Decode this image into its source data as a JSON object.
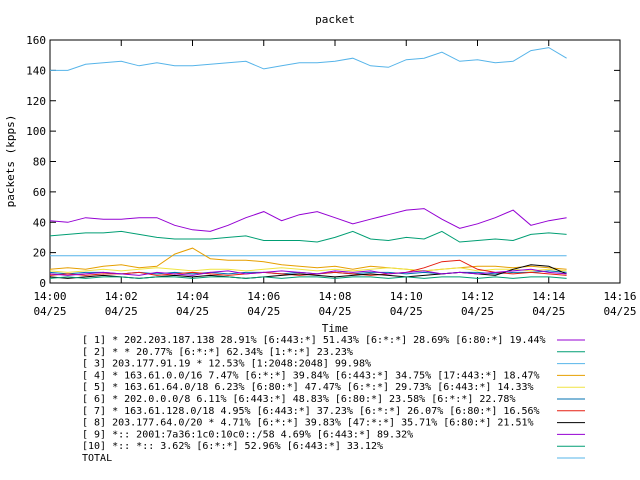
{
  "chart_data": {
    "type": "line",
    "title": "packet",
    "xlabel": "Time",
    "ylabel": "packets (kpps)",
    "ylim": [
      0,
      160
    ],
    "yticks": [
      0,
      20,
      40,
      60,
      80,
      100,
      120,
      140,
      160
    ],
    "xticks": [
      {
        "time": "14:00",
        "date": "04/25"
      },
      {
        "time": "14:02",
        "date": "04/25"
      },
      {
        "time": "14:04",
        "date": "04/25"
      },
      {
        "time": "14:06",
        "date": "04/25"
      },
      {
        "time": "14:08",
        "date": "04/25"
      },
      {
        "time": "14:10",
        "date": "04/25"
      },
      {
        "time": "14:12",
        "date": "04/25"
      },
      {
        "time": "14:14",
        "date": "04/25"
      },
      {
        "time": "14:16",
        "date": "04/25"
      }
    ],
    "xlim": [
      "14:00",
      "14:16"
    ],
    "x": [
      "14:00:00",
      "14:00:30",
      "14:01:00",
      "14:01:30",
      "14:02:00",
      "14:02:30",
      "14:03:00",
      "14:03:30",
      "14:04:00",
      "14:04:30",
      "14:05:00",
      "14:05:30",
      "14:06:00",
      "14:06:30",
      "14:07:00",
      "14:07:30",
      "14:08:00",
      "14:08:30",
      "14:09:00",
      "14:09:30",
      "14:10:00",
      "14:10:30",
      "14:11:00",
      "14:11:30",
      "14:12:00",
      "14:12:30",
      "14:13:00",
      "14:13:30",
      "14:14:00",
      "14:14:30"
    ],
    "grid": false,
    "legend_position": "bottom",
    "series": [
      {
        "name": "[ 1] * 202.203.187.138 28.91%  [6:443:*] 51.43% [6:*:*] 28.69% [6:80:*] 19.44%",
        "color": "#9400d3",
        "values": [
          41,
          40,
          43,
          42,
          42,
          43,
          43,
          38,
          35,
          34,
          38,
          43,
          47,
          41,
          45,
          47,
          43,
          39,
          42,
          45,
          48,
          49,
          42,
          36,
          39,
          43,
          48,
          38,
          41,
          43
        ]
      },
      {
        "name": "[ 2] * * 20.77%  [6:*:*] 62.34% [1:*:*] 23.23%",
        "color": "#009e73",
        "values": [
          31,
          32,
          33,
          33,
          34,
          32,
          30,
          29,
          29,
          29,
          30,
          31,
          28,
          28,
          28,
          27,
          30,
          34,
          29,
          28,
          30,
          29,
          34,
          27,
          28,
          29,
          28,
          32,
          33,
          32
        ]
      },
      {
        "name": "[ 3] 203.177.91.19 * 12.53%  [1:2048:2048] 99.98%",
        "color": "#56b4e9",
        "values": [
          18,
          18,
          18,
          18,
          18,
          18,
          18,
          18,
          18,
          18,
          18,
          18,
          18,
          18,
          18,
          18,
          18,
          18,
          18,
          18,
          18,
          18,
          18,
          18,
          18,
          18,
          18,
          18,
          18,
          18
        ]
      },
      {
        "name": "[ 4] * 163.61.0.0/16 7.47%  [6:*:*] 39.84% [6:443:*] 34.75% [17:443:*] 18.47%",
        "color": "#e69f00",
        "values": [
          9,
          10,
          9,
          11,
          12,
          10,
          11,
          19,
          23,
          16,
          15,
          15,
          14,
          12,
          11,
          10,
          11,
          9,
          11,
          10,
          9,
          8,
          9,
          10,
          11,
          11,
          10,
          11,
          10,
          9
        ]
      },
      {
        "name": "[ 5] * 163.61.64.0/18 6.23%  [6:80:*] 47.47% [6:*:*] 29.73% [6:443:*] 14.33%",
        "color": "#f0e442",
        "values": [
          8,
          7,
          8,
          9,
          8,
          9,
          10,
          9,
          8,
          9,
          9,
          8,
          9,
          10,
          9,
          8,
          9,
          8,
          9,
          10,
          9,
          8,
          9,
          10,
          8,
          9,
          9,
          8,
          9,
          8
        ]
      },
      {
        "name": "[ 6] * 202.0.0.0/8 6.11%  [6:443:*] 48.83% [6:80:*] 23.58% [6:*:*] 22.78%",
        "color": "#0072b2",
        "values": [
          7,
          6,
          7,
          7,
          6,
          7,
          6,
          7,
          6,
          7,
          6,
          7,
          7,
          6,
          7,
          6,
          7,
          6,
          7,
          7,
          6,
          7,
          6,
          7,
          7,
          6,
          7,
          7,
          8,
          7
        ]
      },
      {
        "name": "[ 7] * 163.61.128.0/18 4.95%  [6:443:*] 37.23% [6:*:*] 26.07% [6:80:*] 16.56%",
        "color": "#e51e10",
        "values": [
          5,
          6,
          5,
          6,
          6,
          7,
          5,
          6,
          7,
          6,
          5,
          6,
          7,
          6,
          5,
          6,
          7,
          6,
          5,
          6,
          7,
          10,
          14,
          15,
          9,
          7,
          6,
          7,
          6,
          5
        ]
      },
      {
        "name": "[ 8] 203.177.64.0/20 * 4.71%  [6:*:*] 39.83% [47:*:*] 35.71% [6:80:*] 21.51%",
        "color": "#000000",
        "values": [
          4,
          3,
          4,
          5,
          4,
          3,
          4,
          5,
          4,
          5,
          4,
          3,
          4,
          5,
          6,
          5,
          4,
          5,
          6,
          5,
          4,
          5,
          6,
          7,
          6,
          5,
          9,
          12,
          11,
          6
        ]
      },
      {
        "name": "[ 9] *:: 2001:7a36:1c0:10c0::/58 4.69%  [6:443:*] 89.32%",
        "color": "#9400d3",
        "values": [
          6,
          5,
          6,
          7,
          6,
          5,
          7,
          6,
          5,
          7,
          8,
          6,
          7,
          8,
          7,
          6,
          8,
          7,
          8,
          6,
          7,
          8,
          6,
          7,
          6,
          7,
          8,
          9,
          7,
          6
        ]
      },
      {
        "name": "[10] *:: *:: 3.62%  [6:*:*] 52.96% [6:443:*] 33.12%",
        "color": "#009e73",
        "values": [
          3,
          4,
          3,
          4,
          4,
          3,
          4,
          4,
          3,
          4,
          4,
          3,
          4,
          3,
          4,
          4,
          3,
          4,
          4,
          3,
          4,
          3,
          4,
          4,
          3,
          4,
          3,
          4,
          4,
          3
        ]
      }
    ],
    "total": {
      "name": "TOTAL",
      "color": "#56b4e9",
      "values": [
        140,
        140,
        144,
        145,
        146,
        143,
        145,
        143,
        143,
        144,
        145,
        146,
        141,
        143,
        145,
        145,
        146,
        148,
        143,
        142,
        147,
        148,
        152,
        146,
        147,
        145,
        146,
        153,
        155,
        148
      ]
    }
  }
}
